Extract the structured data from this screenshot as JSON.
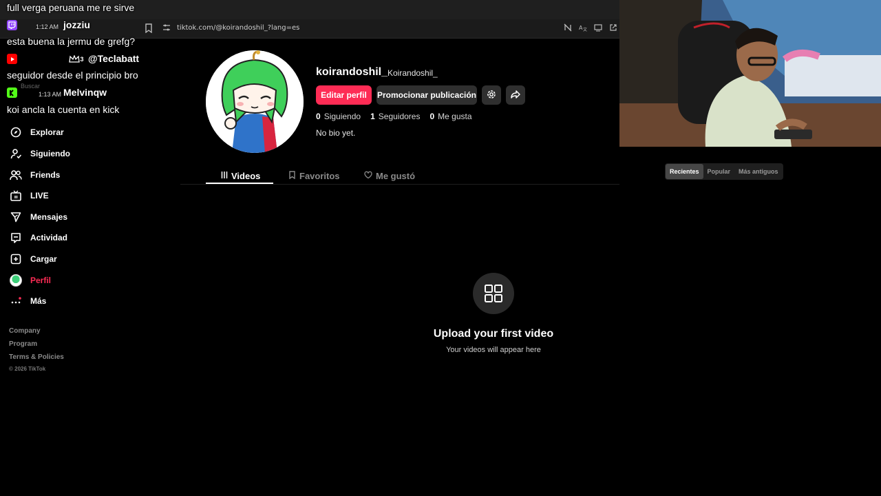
{
  "browser": {
    "url": "tiktok.com/@koirandoshil_?lang=es"
  },
  "sidebar": {
    "search_hint": "Buscar",
    "items": [
      {
        "label": "Explorar",
        "icon": "compass-icon"
      },
      {
        "label": "Siguiendo",
        "icon": "user-follow-icon"
      },
      {
        "label": "Friends",
        "icon": "friends-icon"
      },
      {
        "label": "LIVE",
        "icon": "live-tv-icon"
      },
      {
        "label": "Mensajes",
        "icon": "send-icon"
      },
      {
        "label": "Actividad",
        "icon": "inbox-icon"
      },
      {
        "label": "Cargar",
        "icon": "plus-square-icon"
      },
      {
        "label": "Perfil",
        "icon": "avatar-icon"
      },
      {
        "label": "Más",
        "icon": "more-dots-icon"
      }
    ],
    "footer": [
      "Company",
      "Program",
      "Terms & Policies"
    ],
    "copyright": "© 2026 TikTok"
  },
  "profile": {
    "username": "koirandoshil_",
    "nickname": "Koirandoshil_",
    "edit_button": "Editar perfil",
    "promote_button": "Promocionar publicación",
    "stats": [
      {
        "value": "0",
        "label": "Siguiendo"
      },
      {
        "value": "1",
        "label": "Seguidores"
      },
      {
        "value": "0",
        "label": "Me gusta"
      }
    ],
    "bio": "No bio yet."
  },
  "tabs": [
    {
      "label": "Videos",
      "icon": "grid-lines-icon",
      "active": true
    },
    {
      "label": "Favoritos",
      "icon": "bookmark-icon",
      "active": false
    },
    {
      "label": "Me gustó",
      "icon": "heart-icon",
      "active": false
    }
  ],
  "sort": [
    "Recientes",
    "Popular",
    "Más antiguos"
  ],
  "empty_state": {
    "title": "Upload your first video",
    "subtitle": "Your videos will appear here"
  },
  "chat": {
    "messages": [
      {
        "user": "",
        "time": "",
        "text": "full verga peruana me re sirve"
      },
      {
        "user": "jozziu",
        "time": "1:12 AM",
        "text": "esta buena la jermu de grefg?"
      },
      {
        "user": "@Teclabatt",
        "time": "",
        "badge": "3",
        "text": "seguidor desde el principio bro"
      },
      {
        "user": "Melvinqw",
        "time": "1:13 AM",
        "text": "koi ancla la cuenta en kick"
      }
    ]
  },
  "colors": {
    "accent": "#fe2c55",
    "background": "#000000",
    "kick_green": "#53fc18",
    "twitch_purple": "#9146ff",
    "youtube_red": "#ff0000"
  }
}
